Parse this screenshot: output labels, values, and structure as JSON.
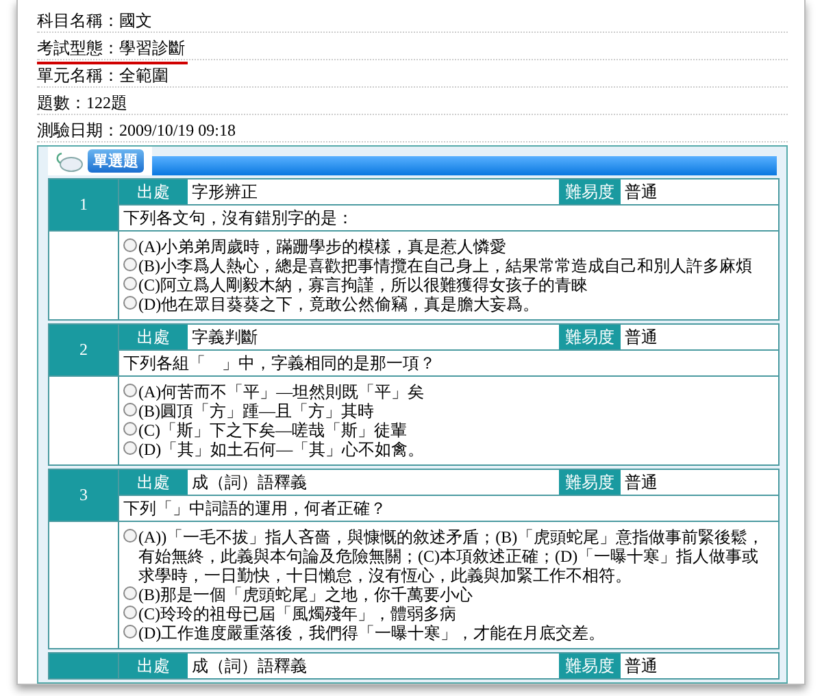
{
  "info": [
    {
      "text": "科目名稱：國文",
      "underlined": false
    },
    {
      "text": "考試型態：學習診斷",
      "underlined": true
    },
    {
      "text": "單元名稱：全範圍",
      "underlined": false
    },
    {
      "text": "題數：122題",
      "underlined": false
    },
    {
      "text": "測驗日期：2009/10/19 09:18",
      "underlined": false
    }
  ],
  "section": {
    "title": "單選題"
  },
  "questions": [
    {
      "number": "1",
      "source_label": "出處",
      "source": "字形辨正",
      "difficulty_label": "難易度",
      "difficulty": "普通",
      "question": "下列各文句，沒有錯別字的是：",
      "options": [
        {
          "text": "(A)小弟弟周歲時，蹣跚學步的模樣，真是惹人憐愛",
          "selected": false
        },
        {
          "text": "(B)小李爲人熱心，總是喜歡把事情攬在自己身上，結果常常造成自己和別人許多麻煩",
          "selected": false
        },
        {
          "text": "(C)阿立爲人剛毅木納，寡言拘謹，所以很難獲得女孩子的青睞",
          "selected": false
        },
        {
          "text": "(D)他在眾目葵葵之下，竟敢公然偷竊，真是膽大妄爲。",
          "selected": false
        }
      ]
    },
    {
      "number": "2",
      "source_label": "出處",
      "source": "字義判斷",
      "difficulty_label": "難易度",
      "difficulty": "普通",
      "question": "下列各組「　」中，字義相同的是那一項？",
      "options": [
        {
          "text": "(A)何苦而不「平」—坦然則既「平」矣",
          "selected": false
        },
        {
          "text": "(B)圓頂「方」踵—且「方」其時",
          "selected": false
        },
        {
          "text": "(C)「斯」下之下矣—嗟哉「斯」徒輩",
          "selected": false
        },
        {
          "text": "(D)「其」如土石何—「其」心不如禽。",
          "selected": false
        }
      ]
    },
    {
      "number": "3",
      "source_label": "出處",
      "source": "成（詞）語釋義",
      "difficulty_label": "難易度",
      "difficulty": "普通",
      "question": "下列「」中詞語的運用，何者正確？",
      "options": [
        {
          "text": "(A))「一毛不拔」指人吝嗇，與慷慨的敘述矛盾；(B)「虎頭蛇尾」意指做事前緊後鬆，有始無終，此義與本句論及危險無關；(C)本項敘述正確；(D)「一曝十寒」指人做事或求學時，一日勤快，十日懶怠，沒有恆心，此義與加緊工作不相符。",
          "selected": false
        },
        {
          "text": "(B)那是一個「虎頭蛇尾」之地，你千萬要小心",
          "selected": false
        },
        {
          "text": "(C)玲玲的祖母已屆「風燭殘年」，體弱多病",
          "selected": false
        },
        {
          "text": "(D)工作進度嚴重落後，我們得「一曝十寒」，才能在月底交差。",
          "selected": false
        }
      ]
    },
    {
      "source_label": "出處",
      "source": "成（詞）語釋義",
      "difficulty_label": "難易度",
      "difficulty": "普通"
    }
  ]
}
